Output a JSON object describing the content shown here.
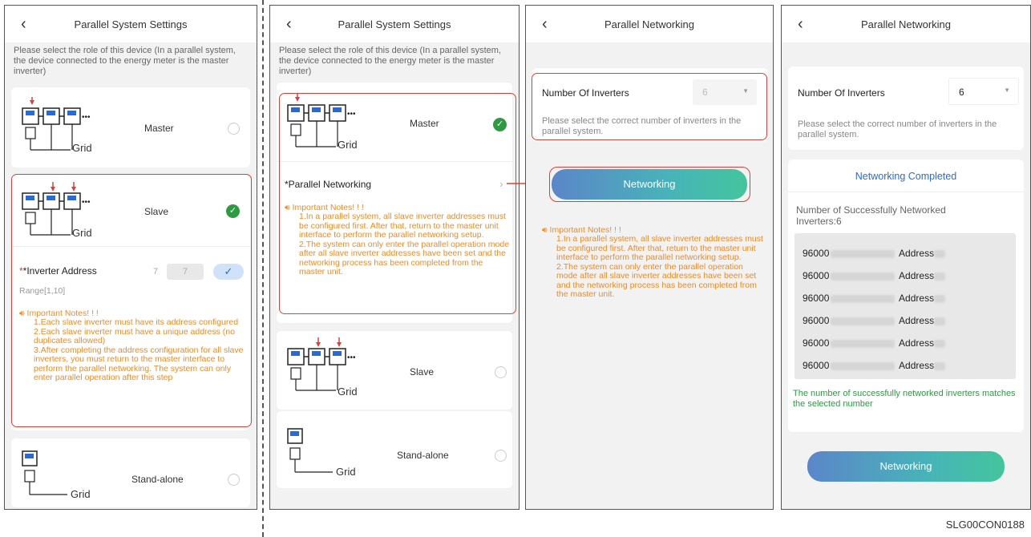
{
  "screens": [
    {
      "title": "Parallel System Settings",
      "description": "Please select the role of this device (In a parallel system, the device connected to the energy meter is the master inverter)",
      "roles": [
        {
          "label": "Master",
          "selected": false
        },
        {
          "label": "Slave",
          "selected": true
        },
        {
          "label": "Stand-alone",
          "selected": false
        }
      ],
      "grid_label": "Grid",
      "inverter_address_label": "*Inverter Address",
      "address_value_1": "7",
      "address_value_2": "7",
      "range_text": "Range[1,10]",
      "notes_title": "Important Notes! ! !",
      "notes": [
        "1.Each slave inverter must have its address configured",
        "2.Each slave inverter must have a unique address (no duplicates allowed)",
        "3.After completing the address configuration for all slave inverters, you must return to the master interface to perform the parallel networking. The system can only enter parallel operation after this step"
      ]
    },
    {
      "title": "Parallel System Settings",
      "description": "Please select the role of this device (In a parallel system, the device connected to the energy meter is the master inverter)",
      "roles": [
        {
          "label": "Master",
          "selected": true
        },
        {
          "label": "Slave",
          "selected": false
        },
        {
          "label": "Stand-alone",
          "selected": false
        }
      ],
      "grid_label": "Grid",
      "parallel_networking_label": "*Parallel Networking",
      "notes_title": "Important Notes! ! !",
      "notes": [
        "1.In a parallel system, all slave inverter addresses must be configured first. After that, return to the master unit interface to perform the parallel networking setup.",
        "2.The system can only enter the parallel operation mode after all slave inverter addresses have been set and the networking process has been completed from the master unit."
      ]
    },
    {
      "title": "Parallel Networking",
      "number_label": "Number Of Inverters",
      "number_value": "6",
      "hint": "Please select the correct number of inverters in the parallel system.",
      "button": "Networking",
      "notes_title": "Important Notes! ! !",
      "notes": [
        "1.In a parallel system, all slave inverter addresses must be configured first. After that, return to the master unit interface to perform the parallel networking setup.",
        "2.The system can only enter the parallel operation mode after all slave inverter addresses have been set and the networking process has been completed from the master unit."
      ]
    },
    {
      "title": "Parallel Networking",
      "number_label": "Number Of Inverters",
      "number_value": "6",
      "hint": "Please select the correct number of inverters in the parallel system.",
      "status": "Networking Completed",
      "count_text": "Number of Successfully Networked Inverters:6",
      "devices": [
        {
          "prefix": "96000",
          "address_label": "Address"
        },
        {
          "prefix": "96000",
          "address_label": "Address"
        },
        {
          "prefix": "96000",
          "address_label": "Address"
        },
        {
          "prefix": "96000",
          "address_label": "Address"
        },
        {
          "prefix": "96000",
          "address_label": "Address"
        },
        {
          "prefix": "96000",
          "address_label": "Address"
        }
      ],
      "match_text": "The number of successfully networked inverters matches the selected number",
      "button": "Networking"
    }
  ],
  "figure_code": "SLG00CON0188",
  "colors": {
    "accent_red": "#d9423a",
    "note_orange": "#f08a24",
    "success_green": "#2e9b43",
    "link_blue": "#2b6bd1"
  }
}
